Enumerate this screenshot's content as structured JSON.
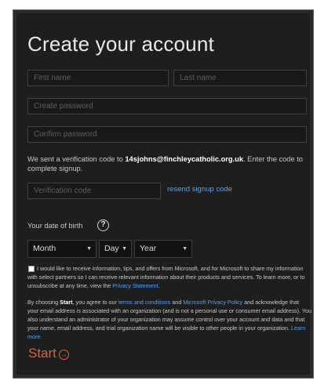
{
  "title": "Create your account",
  "fields": {
    "first_name": "First name",
    "last_name": "Last name",
    "create_password": "Create password",
    "confirm_password": "Confirm password",
    "verification_code": "Verification code"
  },
  "verification": {
    "pre": "We sent a verification code to ",
    "email": "14sjohns@finchleycatholic.org.uk",
    "post": ". Enter the code to complete signup."
  },
  "resend_link": "resend signup code",
  "dob": {
    "label": "Your date of birth",
    "help_icon": "question-circle-icon",
    "help_glyph": "?",
    "month": "Month",
    "day": "Day",
    "year": "Year",
    "caret": "▼"
  },
  "offers": {
    "text": "I would like to receive information, tips, and offers from Microsoft, and for Microsoft to share my information with select partners so I can receive relevant information about their products and services. To learn more, or to unsubscribe at any time, view the ",
    "link": "Privacy Statement",
    "end": "."
  },
  "terms": {
    "pre_strong": "By choosing ",
    "strong": "Start",
    "after_strong": ", you agree to our ",
    "link1": "terms and conditions",
    "and": " and ",
    "link2": "Microsoft Privacy Policy",
    "rest": " and acknowledge that your email address is associated with an organization (and is not a personal use or consumer email address). You also understand an administrator of your organization may assume control over your account and data and that your name, email address, and trial organization name will be visible to other people in your organization. ",
    "link3": "Learn more."
  },
  "start_button": "Start",
  "start_icon": "arrow-circle-right-icon",
  "start_glyph": "→",
  "colors": {
    "background": "#1e1e1e",
    "accent": "#e8602c",
    "link": "#4aa3ff"
  }
}
